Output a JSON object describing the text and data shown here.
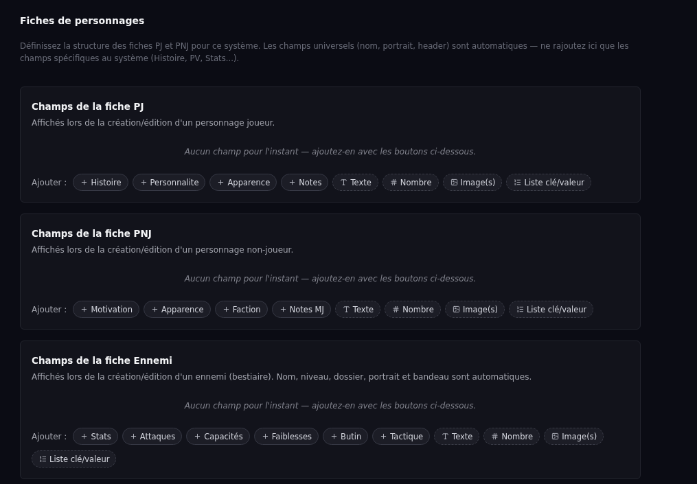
{
  "page": {
    "title": "Fiches de personnages",
    "description": "Définissez la structure des fiches PJ et PNJ pour ce système. Les champs universels (nom, portrait, header) sont automatiques — ne rajoutez ici que les champs spécifiques au système (Histoire, PV, Stats...)."
  },
  "sections": [
    {
      "title": "Champs de la fiche PJ",
      "subtitle": "Affichés lors de la création/édition d'un personnage joueur.",
      "empty_message": "Aucun champ pour l'instant — ajoutez-en avec les boutons ci-dessous.",
      "add_label": "Ajouter :",
      "buttons": [
        {
          "kind": "preset",
          "label": "Histoire"
        },
        {
          "kind": "preset",
          "label": "Personnalite"
        },
        {
          "kind": "preset",
          "label": "Apparence"
        },
        {
          "kind": "preset",
          "label": "Notes"
        },
        {
          "kind": "text",
          "label": "Texte"
        },
        {
          "kind": "number",
          "label": "Nombre"
        },
        {
          "kind": "image",
          "label": "Image(s)"
        },
        {
          "kind": "list",
          "label": "Liste clé/valeur"
        }
      ]
    },
    {
      "title": "Champs de la fiche PNJ",
      "subtitle": "Affichés lors de la création/édition d'un personnage non-joueur.",
      "empty_message": "Aucun champ pour l'instant — ajoutez-en avec les boutons ci-dessous.",
      "add_label": "Ajouter :",
      "buttons": [
        {
          "kind": "preset",
          "label": "Motivation"
        },
        {
          "kind": "preset",
          "label": "Apparence"
        },
        {
          "kind": "preset",
          "label": "Faction"
        },
        {
          "kind": "preset",
          "label": "Notes MJ"
        },
        {
          "kind": "text",
          "label": "Texte"
        },
        {
          "kind": "number",
          "label": "Nombre"
        },
        {
          "kind": "image",
          "label": "Image(s)"
        },
        {
          "kind": "list",
          "label": "Liste clé/valeur"
        }
      ]
    },
    {
      "title": "Champs de la fiche Ennemi",
      "subtitle": "Affichés lors de la création/édition d'un ennemi (bestiaire). Nom, niveau, dossier, portrait et bandeau sont automatiques.",
      "empty_message": "Aucun champ pour l'instant — ajoutez-en avec les boutons ci-dessous.",
      "add_label": "Ajouter :",
      "buttons": [
        {
          "kind": "preset",
          "label": "Stats"
        },
        {
          "kind": "preset",
          "label": "Attaques"
        },
        {
          "kind": "preset",
          "label": "Capacités"
        },
        {
          "kind": "preset",
          "label": "Faiblesses"
        },
        {
          "kind": "preset",
          "label": "Butin"
        },
        {
          "kind": "preset",
          "label": "Tactique"
        },
        {
          "kind": "text",
          "label": "Texte"
        },
        {
          "kind": "number",
          "label": "Nombre"
        },
        {
          "kind": "image",
          "label": "Image(s)"
        },
        {
          "kind": "list",
          "label": "Liste clé/valeur"
        }
      ]
    }
  ]
}
